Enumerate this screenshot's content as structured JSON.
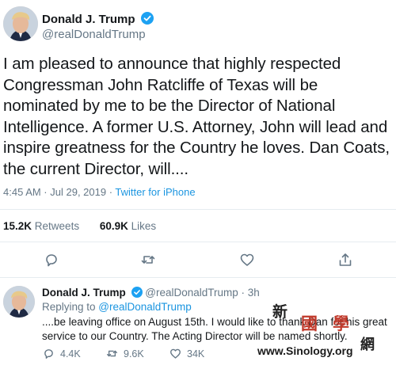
{
  "tweet": {
    "author_name": "Donald J. Trump",
    "author_handle": "@realDonaldTrump",
    "text": "I am pleased to announce that highly respected Congressman John Ratcliffe of Texas will be nominated by me to be the Director of National Intelligence. A former U.S. Attorney, John will lead and inspire greatness for the Country he loves. Dan Coats, the current Director, will....",
    "time": "4:45 AM · Jul 29, 2019 · ",
    "source": "Twitter for iPhone",
    "retweets_count": "15.2K",
    "retweets_label": "Retweets",
    "likes_count": "60.9K",
    "likes_label": "Likes",
    "accent_color": "#1da1f2"
  },
  "reply": {
    "author_name": "Donald J. Trump",
    "handle_time": "@realDonaldTrump · 3h",
    "replying_to_label": "Replying to ",
    "replying_to_handle": "@realDonaldTrump",
    "text": "....be leaving office on August 15th. I would like to thank Dan for his great service to our Country. The Acting Director will be named shortly.",
    "reply_count": "4.4K",
    "retweet_count": "9.6K",
    "like_count": "34K"
  },
  "watermark": {
    "chars": [
      "新",
      "國",
      "學",
      "網"
    ],
    "url": "www.Sinology.org"
  },
  "icons": [
    "verified-badge-icon",
    "reply-icon",
    "retweet-icon",
    "like-icon",
    "share-icon"
  ]
}
